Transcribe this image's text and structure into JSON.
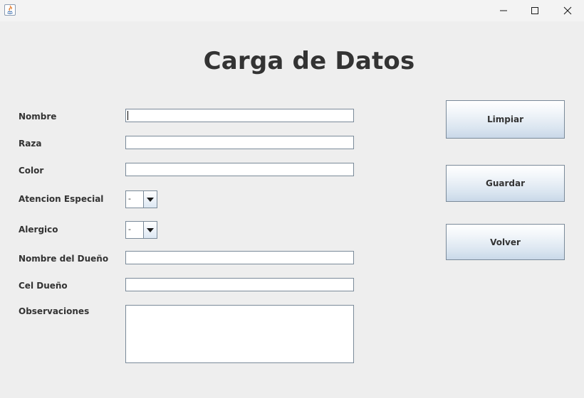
{
  "window": {
    "icons": {
      "app": "java-icon",
      "minimize": "minimize-icon",
      "maximize": "maximize-icon",
      "close": "close-icon"
    }
  },
  "form": {
    "title": "Carga de Datos",
    "fields": {
      "nombre": {
        "label": "Nombre",
        "value": ""
      },
      "raza": {
        "label": "Raza",
        "value": ""
      },
      "color": {
        "label": "Color",
        "value": ""
      },
      "atencion_especial": {
        "label": "Atencion Especial",
        "selected": "-"
      },
      "alergico": {
        "label": "Alergico",
        "selected": "-"
      },
      "nombre_dueno": {
        "label": "Nombre del Dueño",
        "value": ""
      },
      "cel_dueno": {
        "label": "Cel Dueño",
        "value": ""
      },
      "observaciones": {
        "label": "Observaciones",
        "value": ""
      }
    }
  },
  "buttons": {
    "limpiar": "Limpiar",
    "guardar": "Guardar",
    "volver": "Volver"
  },
  "colors": {
    "background": "#eeeeee",
    "field_border": "#7a8a99",
    "text": "#333333",
    "button_gradient_top": "#ffffff",
    "button_gradient_bottom": "#c9d8e8"
  }
}
